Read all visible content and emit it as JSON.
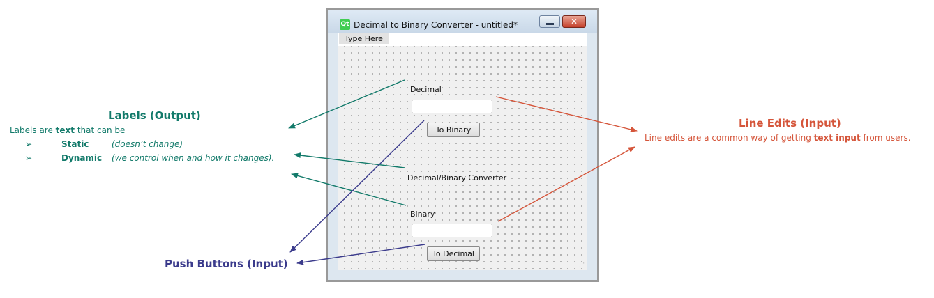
{
  "annotations": {
    "labels": {
      "heading": "Labels (Output)",
      "desc_prefix": "Labels are ",
      "desc_keyword": "text",
      "desc_suffix": " that can be",
      "bullets": [
        {
          "marker": "➢",
          "keyword": "Static",
          "note": "(doesn’t change)"
        },
        {
          "marker": "➢",
          "keyword": "Dynamic",
          "note": "(we control when and how it changes)."
        }
      ],
      "color": "#127a6a"
    },
    "push_buttons": {
      "heading": "Push Buttons (Input)",
      "color": "#3b3b8c"
    },
    "line_edits": {
      "heading": "Line Edits (Input)",
      "desc_prefix": "Line edits are a common way of getting ",
      "desc_keyword": "text input",
      "desc_suffix": " from users.",
      "color": "#d5553a"
    }
  },
  "window": {
    "logo_text": "Qt",
    "title": "Decimal to Binary Converter - untitled*",
    "close_glyph": "✕",
    "menu": {
      "type_here": "Type Here"
    },
    "form": {
      "decimal_label": "Decimal",
      "to_binary_button": "To Binary",
      "converter_label": "Decimal/Binary Converter",
      "binary_label": "Binary",
      "to_decimal_button": "To Decimal",
      "decimal_value": "",
      "binary_value": ""
    }
  }
}
